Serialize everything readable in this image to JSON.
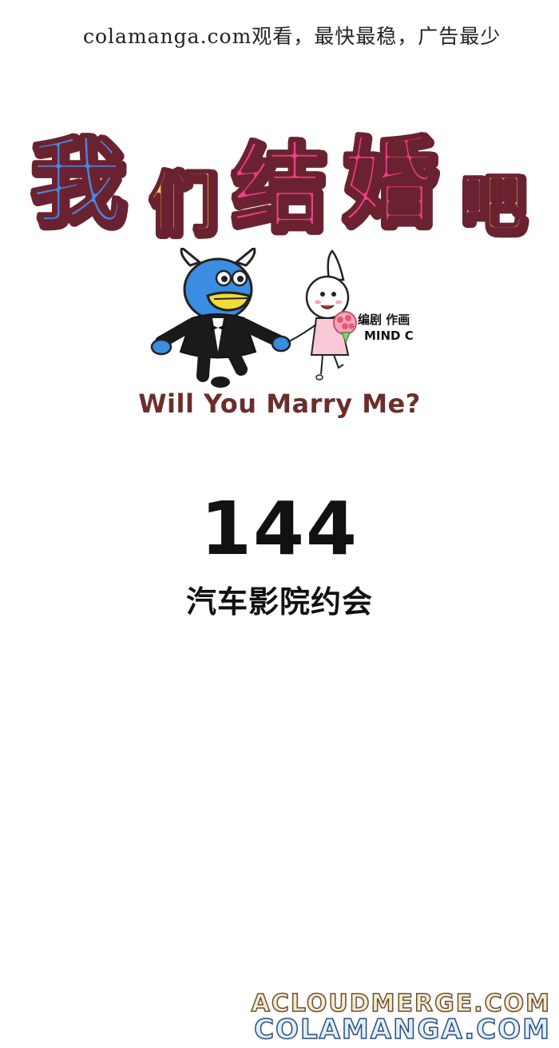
{
  "watermark_top": "colamanga.com观看，最快最稳，广告最少",
  "title": {
    "chars": [
      "我",
      "们",
      "结",
      "婚",
      "吧"
    ],
    "colors": [
      "#4a86e0",
      "#f3d35a",
      "#ef3f86",
      "#ef3f86",
      "#f3d35a"
    ],
    "outline": "#6b2230"
  },
  "credits": {
    "line1": "编剧 作画",
    "line2": "MIND C"
  },
  "subtitle": "Will You Marry Me?",
  "chapter": {
    "number": "144",
    "title": "汽车影院约会"
  },
  "bottom_watermark": {
    "line1": "ACLOUDMERGE.COM",
    "line2": "COLAMANGA.COM"
  }
}
